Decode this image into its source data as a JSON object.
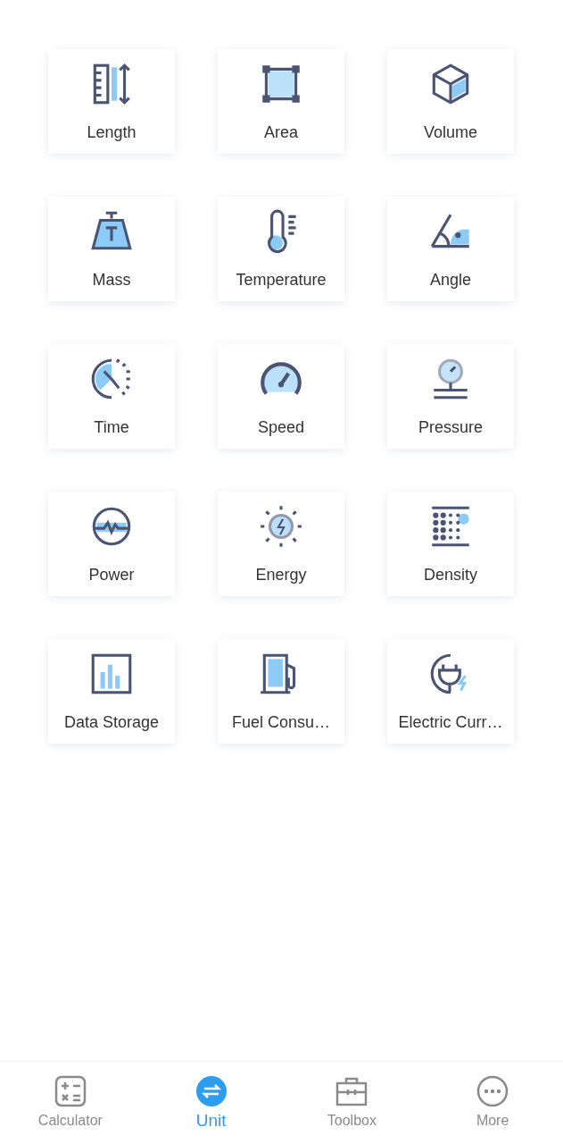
{
  "categories": [
    {
      "label": "Length"
    },
    {
      "label": "Area"
    },
    {
      "label": "Volume"
    },
    {
      "label": "Mass"
    },
    {
      "label": "Temperature"
    },
    {
      "label": "Angle"
    },
    {
      "label": "Time"
    },
    {
      "label": "Speed"
    },
    {
      "label": "Pressure"
    },
    {
      "label": "Power"
    },
    {
      "label": "Energy"
    },
    {
      "label": "Density"
    },
    {
      "label": "Data Storage"
    },
    {
      "label": "Fuel Consu…"
    },
    {
      "label": "Electric Curr…"
    }
  ],
  "tabs": [
    {
      "label": "Calculator",
      "selected": false
    },
    {
      "label": "Unit",
      "selected": true
    },
    {
      "label": "Toolbox",
      "selected": false
    },
    {
      "label": "More",
      "selected": false
    }
  ]
}
